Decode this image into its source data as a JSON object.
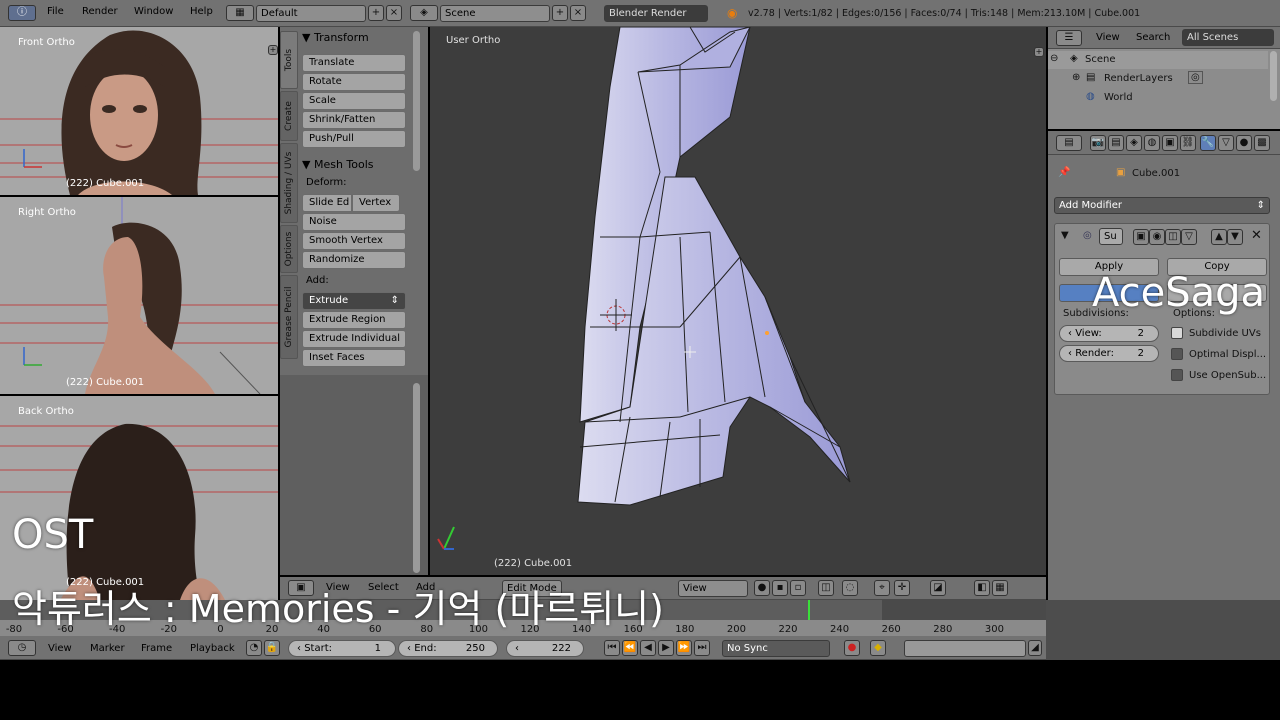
{
  "topbar": {
    "menus": [
      "File",
      "Render",
      "Window",
      "Help"
    ],
    "layout": "Default",
    "scene": "Scene",
    "engine": "Blender Render",
    "stats": "v2.78 | Verts:1/82 | Edges:0/156 | Faces:0/74 | Tris:148 | Mem:213.10M | Cube.001"
  },
  "viewports": {
    "front": {
      "label": "Front Ortho",
      "object": "(222) Cube.001"
    },
    "right": {
      "label": "Right Ortho",
      "object": "(222) Cube.001"
    },
    "back": {
      "label": "Back Ortho",
      "object": "(222) Cube.001"
    },
    "main": {
      "label": "User Ortho",
      "object": "(222) Cube.001"
    }
  },
  "toolshelf": {
    "tabs": [
      "Tools",
      "Create",
      "Shading / UVs",
      "Options",
      "Grease Pencil"
    ],
    "transform": {
      "title": "Transform",
      "buttons": [
        "Translate",
        "Rotate",
        "Scale",
        "Shrink/Fatten",
        "Push/Pull"
      ]
    },
    "meshtools": {
      "title": "Mesh Tools",
      "deform_label": "Deform:",
      "slide_edge": "Slide Ed",
      "vertex": "Vertex",
      "buttons": [
        "Noise",
        "Smooth Vertex",
        "Randomize"
      ],
      "add_label": "Add:",
      "extrude": "Extrude",
      "add_buttons": [
        "Extrude Region",
        "Extrude Individual",
        "Inset Faces"
      ]
    }
  },
  "outliner": {
    "view": "View",
    "search": "Search",
    "filter": "All Scenes",
    "items": [
      "Scene",
      "RenderLayers",
      "World"
    ]
  },
  "properties": {
    "object": "Cube.001",
    "add_modifier": "Add Modifier",
    "modifier_name": "Su",
    "apply": "Apply",
    "copy": "Copy",
    "subdivisions_label": "Subdivisions:",
    "options_label": "Options:",
    "view_label": "View:",
    "view_value": "2",
    "render_label": "Render:",
    "render_value": "2",
    "opt1": "Subdivide UVs",
    "opt2": "Optimal Displ...",
    "opt3": "Use OpenSub..."
  },
  "view3d_header": {
    "view": "View",
    "select": "Select",
    "add": "Add",
    "mode": "Edit Mode",
    "view2": "View"
  },
  "timeline": {
    "ticks": [
      "-80",
      "-60",
      "-40",
      "-20",
      "0",
      "20",
      "40",
      "60",
      "80",
      "100",
      "120",
      "140",
      "160",
      "180",
      "200",
      "220",
      "240",
      "260",
      "280",
      "300"
    ],
    "menus": [
      "View",
      "Marker",
      "Frame",
      "Playback"
    ],
    "start_label": "Start:",
    "start": "1",
    "end_label": "End:",
    "end": "250",
    "current": "222",
    "sync": "No Sync"
  },
  "overlay": {
    "watermark": "AceSaga",
    "caption_line1": "OST",
    "caption_line2": "악튜러스 : Memories - 기억 (마르튀니)"
  }
}
